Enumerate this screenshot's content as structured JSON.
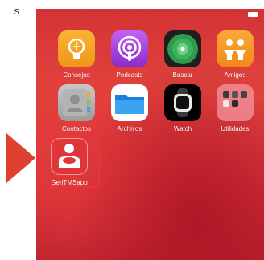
{
  "caption": {
    "fragment": "s"
  },
  "home_screen": {
    "rows": [
      [
        {
          "label": "Consejos",
          "icon": "tips-lightbulb-icon",
          "color": "#f3a21c"
        },
        {
          "label": "Podcasts",
          "icon": "podcasts-icon",
          "color": "#9d3bd6"
        },
        {
          "label": "Buscar",
          "icon": "find-my-radar-icon",
          "color": "#2a8a3e"
        },
        {
          "label": "Amigos",
          "icon": "friends-icon",
          "color": "#f4941a"
        }
      ],
      [
        {
          "label": "Contactos",
          "icon": "contacts-icon",
          "color": "#a9a9a9"
        },
        {
          "label": "Archivos",
          "icon": "files-folder-icon",
          "color": "#2a8ee6"
        },
        {
          "label": "Watch",
          "icon": "watch-icon",
          "color": "#111111"
        },
        {
          "label": "Utilidades",
          "icon": "utilities-folder-icon",
          "color": "#ec6a74"
        }
      ],
      [
        {
          "label": "GeriTMSapp",
          "icon": "geritmsapp-person-icon",
          "color": "#e0353b"
        }
      ]
    ]
  },
  "colors": {
    "wallpaper": "#d43235",
    "highlight": "#e8353b",
    "arrow": "#e0402f"
  }
}
